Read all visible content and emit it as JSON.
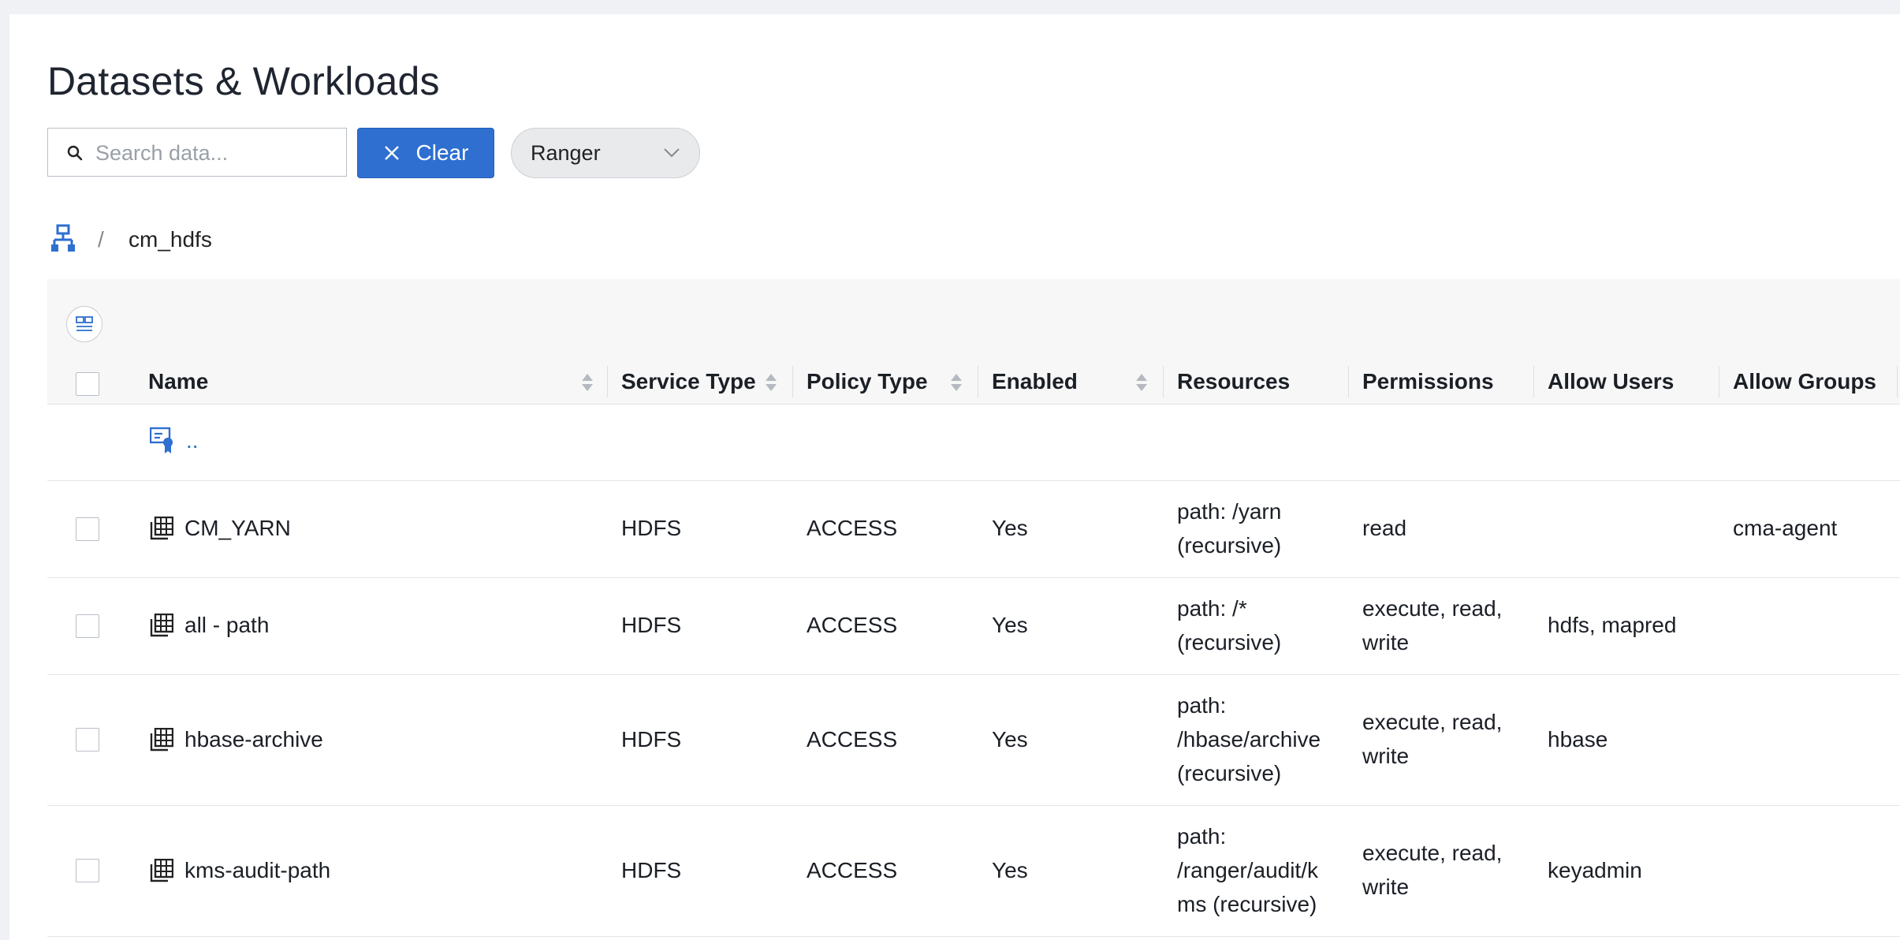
{
  "page": {
    "title": "Datasets & Workloads"
  },
  "toolbar": {
    "search_placeholder": "Search data...",
    "search_value": "",
    "clear_label": "Clear",
    "source_select": "Ranger"
  },
  "breadcrumb": {
    "current": "cm_hdfs",
    "separator": "/"
  },
  "table": {
    "columns": [
      "Name",
      "Service Type",
      "Policy Type",
      "Enabled",
      "Resources",
      "Permissions",
      "Allow Users",
      "Allow Groups"
    ],
    "parent_row": {
      "label": ".."
    },
    "rows": [
      {
        "name": "CM_YARN",
        "service_type": "HDFS",
        "policy_type": "ACCESS",
        "enabled": "Yes",
        "resources": [
          "path: /yarn",
          "(recursive)"
        ],
        "permissions": [
          "read"
        ],
        "allow_users": "",
        "allow_groups": "cma-agent"
      },
      {
        "name": "all - path",
        "service_type": "HDFS",
        "policy_type": "ACCESS",
        "enabled": "Yes",
        "resources": [
          "path: /*",
          "(recursive)"
        ],
        "permissions": [
          "execute, read,",
          "write"
        ],
        "allow_users": "hdfs, mapred",
        "allow_groups": ""
      },
      {
        "name": "hbase-archive",
        "service_type": "HDFS",
        "policy_type": "ACCESS",
        "enabled": "Yes",
        "resources": [
          "path:",
          "/hbase/archive",
          "(recursive)"
        ],
        "permissions": [
          "execute, read,",
          "write"
        ],
        "allow_users": "hbase",
        "allow_groups": ""
      },
      {
        "name": "kms-audit-path",
        "service_type": "HDFS",
        "policy_type": "ACCESS",
        "enabled": "Yes",
        "resources": [
          "path:",
          "/ranger/audit/k",
          "ms (recursive)"
        ],
        "permissions": [
          "execute, read,",
          "write"
        ],
        "allow_users": "keyadmin",
        "allow_groups": ""
      }
    ]
  },
  "icons": {
    "search": "search-icon",
    "clear": "close-icon",
    "dropdown": "chevron-down-icon",
    "breadcrumb_home": "hierarchy-icon",
    "column_settings": "columns-icon",
    "parent": "parent-dataset-icon",
    "table_row": "table-icon"
  },
  "colors": {
    "accent": "#2e6fd0",
    "header_bg": "#f7f7f7",
    "page_bg": "#eff1f5"
  }
}
